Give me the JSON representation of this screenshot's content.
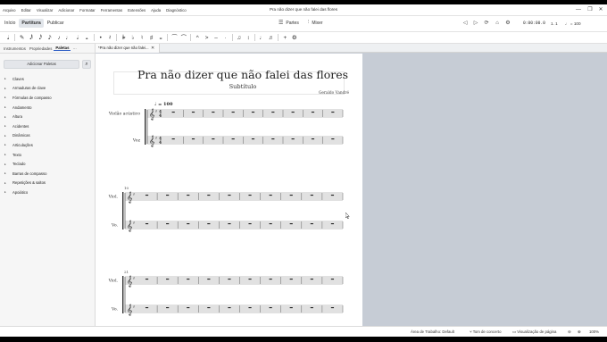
{
  "window": {
    "title": "Pra não dizer que não falei das flores",
    "controls": [
      "—",
      "❐",
      "✕"
    ]
  },
  "menubar": [
    "Arquivo",
    "Editar",
    "Visualizar",
    "Adicionar",
    "Formatar",
    "Ferramentas",
    "Extensões",
    "Ajuda",
    "Diagnóstico"
  ],
  "main_tabs": [
    {
      "label": "Início",
      "active": false
    },
    {
      "label": "Partitura",
      "active": true
    },
    {
      "label": "Publicar",
      "active": false
    }
  ],
  "center_buttons": {
    "parts": {
      "icon": "parts-icon",
      "glyph": "☰",
      "label": "Partes"
    },
    "mixer": {
      "icon": "mixer-icon",
      "glyph": "⫶",
      "label": "Mixer"
    }
  },
  "playback": {
    "controls": [
      {
        "name": "rewind-icon",
        "glyph": "◁"
      },
      {
        "name": "play-icon",
        "glyph": "▷"
      },
      {
        "name": "loop-icon",
        "glyph": "⟳"
      },
      {
        "name": "metronome-icon",
        "glyph": "⌂"
      },
      {
        "name": "settings-icon",
        "glyph": "⚙"
      }
    ],
    "time": "0:00:00.0",
    "position": "1. 1",
    "tempo": "♩ = 100"
  },
  "note_toolbar": [
    {
      "name": "note-input-icon",
      "glyph": "𝅘𝅥"
    },
    {
      "name": "sep",
      "glyph": ""
    },
    {
      "name": "pen-icon",
      "glyph": "✎"
    },
    {
      "name": "sixtyfourth-note-icon",
      "glyph": "𝅘𝅥𝅱"
    },
    {
      "name": "thirtysecond-note-icon",
      "glyph": "𝅘𝅥𝅰"
    },
    {
      "name": "sixteenth-note-icon",
      "glyph": "𝅘𝅥𝅯"
    },
    {
      "name": "eighth-note-icon",
      "glyph": "♪"
    },
    {
      "name": "quarter-note-icon",
      "glyph": "♩"
    },
    {
      "name": "half-note-icon",
      "glyph": "𝅗𝅥"
    },
    {
      "name": "whole-note-icon",
      "glyph": "𝅝"
    },
    {
      "name": "sep",
      "glyph": ""
    },
    {
      "name": "dot-icon",
      "glyph": "•"
    },
    {
      "name": "rest-icon",
      "glyph": "𝄽"
    },
    {
      "name": "sep",
      "glyph": ""
    },
    {
      "name": "double-flat-icon",
      "glyph": "𝄫"
    },
    {
      "name": "flat-icon",
      "glyph": "♭"
    },
    {
      "name": "natural-icon",
      "glyph": "♮"
    },
    {
      "name": "sharp-icon",
      "glyph": "♯"
    },
    {
      "name": "double-sharp-icon",
      "glyph": "𝄪"
    },
    {
      "name": "sep",
      "glyph": ""
    },
    {
      "name": "tie-icon",
      "glyph": "⁀"
    },
    {
      "name": "slur-icon",
      "glyph": "⌒"
    },
    {
      "name": "sep",
      "glyph": ""
    },
    {
      "name": "marcato-icon",
      "glyph": "^"
    },
    {
      "name": "accent-icon",
      "glyph": ">"
    },
    {
      "name": "tenuto-icon",
      "glyph": "–"
    },
    {
      "name": "staccato-icon",
      "glyph": "·"
    },
    {
      "name": "sep",
      "glyph": ""
    },
    {
      "name": "tuplet-icon",
      "glyph": "♫"
    },
    {
      "name": "flip-icon",
      "glyph": "↕"
    },
    {
      "name": "sep",
      "glyph": ""
    },
    {
      "name": "voice1-icon",
      "glyph": "♩"
    },
    {
      "name": "voice2-icon",
      "glyph": "♬"
    },
    {
      "name": "sep",
      "glyph": ""
    },
    {
      "name": "add-icon",
      "glyph": "+"
    },
    {
      "name": "customize-icon",
      "glyph": "⚙"
    }
  ],
  "panel_tabs": [
    {
      "label": "Instrumentos",
      "active": false
    },
    {
      "label": "Propriedades",
      "active": false
    },
    {
      "label": "Paletas",
      "active": true
    },
    {
      "label": "···",
      "active": false
    }
  ],
  "add_palettes_label": "Adicionar Paletas",
  "palettes": [
    "Claves",
    "Armaduras de clave",
    "Fórmulas de compasso",
    "Andamento",
    "Altura",
    "Acidentes",
    "Dinâmicas",
    "Articulações",
    "Texto",
    "Teclado",
    "Barras de compasso",
    "Repetições & saltos",
    "Apoiático"
  ],
  "document_tab": {
    "label": "*Pra não dizer que não falei...",
    "close": "✕"
  },
  "score": {
    "title": "Pra não dizer que não falei das flores",
    "subtitle": "Subtítulo",
    "composer": "Geraldo Vandré",
    "tempo_mark": "♩ = 100",
    "systems": [
      {
        "measure_number": "",
        "instruments": [
          "Violão acústico",
          "Voz"
        ]
      },
      {
        "measure_number": "10",
        "instruments": [
          "Viol.",
          "Vo."
        ]
      },
      {
        "measure_number": "21",
        "instruments": [
          "Viol.",
          "Vo."
        ]
      }
    ]
  },
  "statusbar": {
    "workspace": "Área de Trabalho: Default",
    "concert_pitch": "Tom de concerto",
    "page_view": "Visualização de página",
    "zoom": "100%"
  }
}
